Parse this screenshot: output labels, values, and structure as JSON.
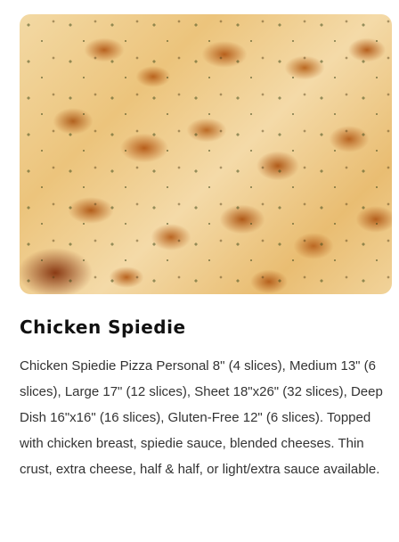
{
  "item": {
    "image_alt": "Chicken Spiedie pizza close-up",
    "title": "Chicken Spiedie",
    "description": "Chicken Spiedie Pizza Personal 8\" (4 slices), Medium 13\" (6 slices), Large 17\" (12 slices), Sheet 18\"x26\" (32 slices), Deep Dish 16\"x16\" (16 slices), Gluten-Free 12\" (6 slices). Topped with chicken breast, spiedie sauce, blended cheeses. Thin crust, extra cheese, half & half, or light/extra sauce available."
  }
}
